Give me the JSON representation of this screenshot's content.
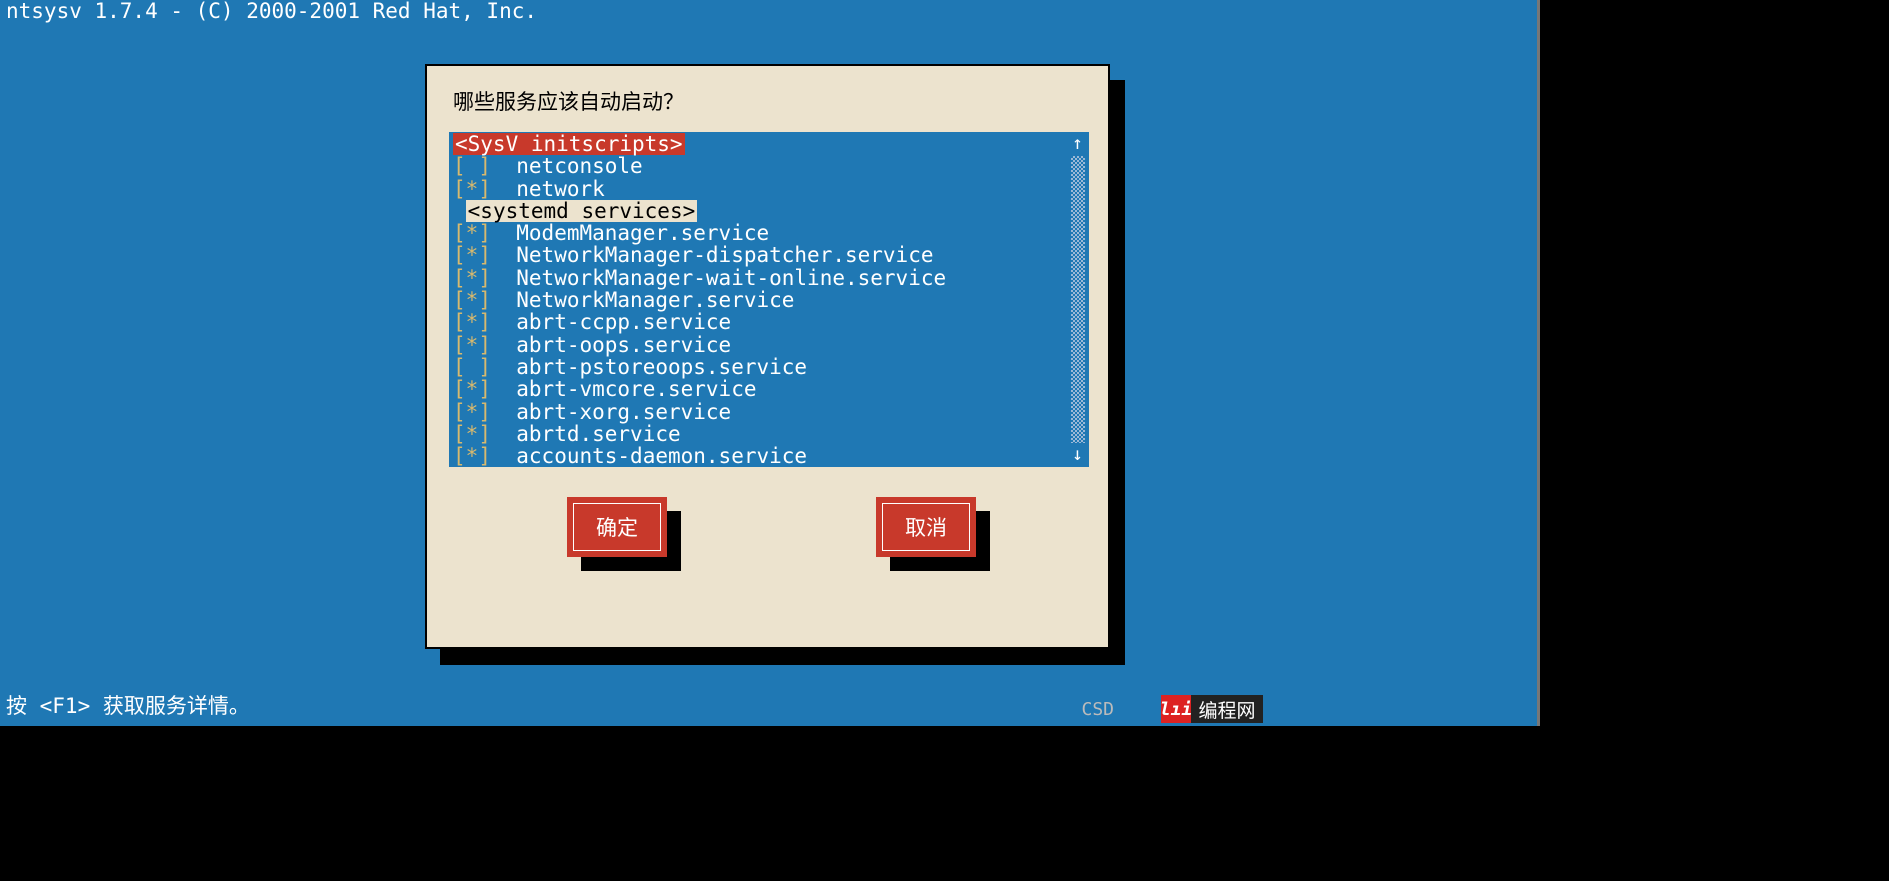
{
  "header": "ntsysv 1.7.4 - (C) 2000-2001 Red Hat, Inc.",
  "dialog": {
    "title": "哪些服务应该自动启动？",
    "groups": {
      "sysv": "<SysV initscripts>",
      "systemd": "<systemd services>"
    },
    "items": [
      {
        "check": " ",
        "name": "netconsole"
      },
      {
        "check": "*",
        "name": "network"
      },
      {
        "check": "*",
        "name": "ModemManager.service"
      },
      {
        "check": "*",
        "name": "NetworkManager-dispatcher.service"
      },
      {
        "check": "*",
        "name": "NetworkManager-wait-online.service"
      },
      {
        "check": "*",
        "name": "NetworkManager.service"
      },
      {
        "check": "*",
        "name": "abrt-ccpp.service"
      },
      {
        "check": "*",
        "name": "abrt-oops.service"
      },
      {
        "check": " ",
        "name": "abrt-pstoreoops.service"
      },
      {
        "check": "*",
        "name": "abrt-vmcore.service"
      },
      {
        "check": "*",
        "name": "abrt-xorg.service"
      },
      {
        "check": "*",
        "name": "abrtd.service"
      },
      {
        "check": "*",
        "name": "accounts-daemon.service"
      }
    ],
    "buttons": {
      "ok": "确定",
      "cancel": "取消"
    }
  },
  "footer": "按 <F1> 获取服务详情。",
  "watermark": {
    "csdn": "CSD",
    "badge": "lıi",
    "site": "编程网"
  }
}
